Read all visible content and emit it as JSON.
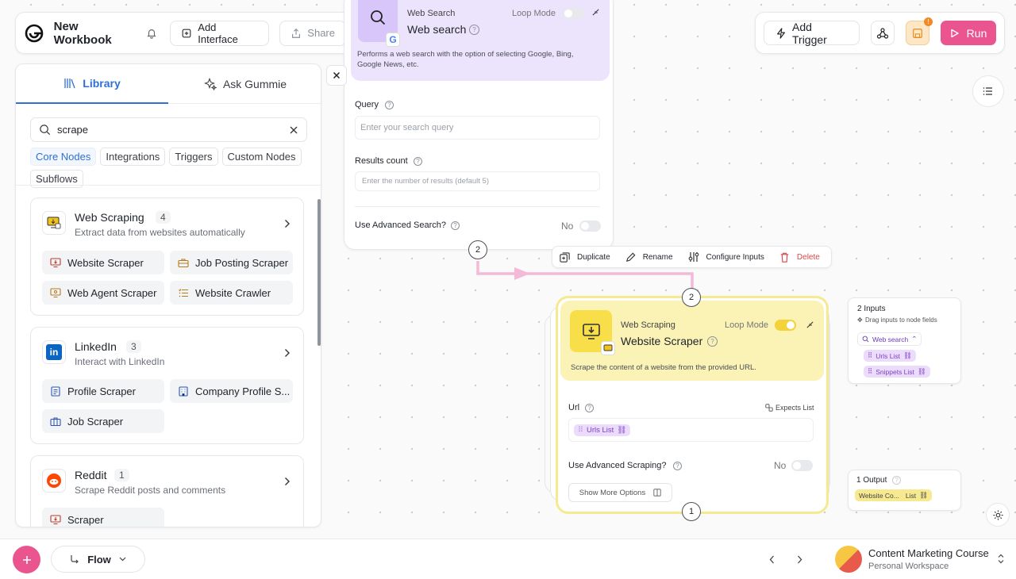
{
  "header": {
    "title": "New Workbook",
    "add_interface": "Add Interface",
    "share": "Share",
    "add_trigger": "Add Trigger",
    "run": "Run",
    "save_badge": "!"
  },
  "library": {
    "tab_library": "Library",
    "tab_ask": "Ask Gummie",
    "search_value": "scrape",
    "filters": [
      "Core Nodes",
      "Integrations",
      "Triggers",
      "Custom Nodes",
      "Subflows"
    ],
    "groups": [
      {
        "title": "Web Scraping",
        "count": "4",
        "desc": "Extract data from websites automatically",
        "items": [
          "Website Scraper",
          "Job Posting Scraper",
          "Web Agent Scraper",
          "Website Crawler"
        ]
      },
      {
        "title": "LinkedIn",
        "count": "3",
        "desc": "Interact with LinkedIn",
        "items": [
          "Profile Scraper",
          "Company Profile S...",
          "Job Scraper"
        ]
      },
      {
        "title": "Reddit",
        "count": "1",
        "desc": "Scrape Reddit posts and comments",
        "items": [
          "Scraper"
        ]
      }
    ]
  },
  "web_search_node": {
    "category": "Web Search",
    "title": "Web search",
    "loop_mode": "Loop Mode",
    "description": "Performs a web search with the option of selecting Google, Bing, Google News, etc.",
    "query_label": "Query",
    "query_placeholder": "Enter your search query",
    "results_label": "Results count",
    "results_placeholder": "Enter the number of results (default 5)",
    "advanced_label": "Use Advanced Search?",
    "advanced_value": "No",
    "badge": "2"
  },
  "node_toolbar": {
    "duplicate": "Duplicate",
    "rename": "Rename",
    "configure": "Configure Inputs",
    "delete": "Delete"
  },
  "scraper_node": {
    "category": "Web Scraping",
    "title": "Website Scraper",
    "loop_mode": "Loop Mode",
    "description": "Scrape the content of a website from the provided URL.",
    "url_label": "Url",
    "expects_list": "Expects List",
    "url_tag": "Urls List",
    "advanced_label": "Use Advanced Scraping?",
    "advanced_value": "No",
    "show_more": "Show More Options",
    "top_badge": "2",
    "bottom_badge": "1"
  },
  "inputs_panel": {
    "title": "2 Inputs",
    "hint": "Drag inputs to node fields",
    "source": "Web search",
    "tags": [
      "Urls List",
      "Snippets List"
    ]
  },
  "output_panel": {
    "title": "1 Output",
    "tag_name": "Website Co...",
    "tag_type": "List"
  },
  "footer": {
    "flow": "Flow",
    "workspace_title": "Content Marketing Course",
    "workspace_sub": "Personal Workspace"
  },
  "colors": {
    "accent_pink": "#e84f8a",
    "scraper_yellow": "#f6e98f",
    "web_search_purple": "#ece4fd",
    "link_blue": "#2f6fd6"
  }
}
